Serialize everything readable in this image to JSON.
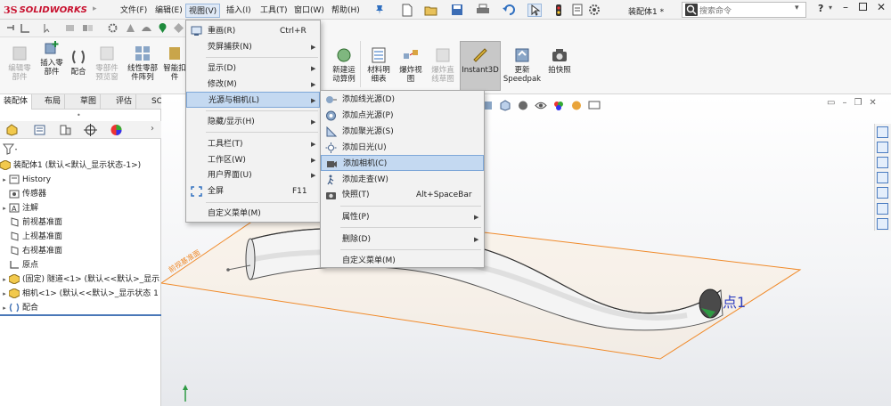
{
  "app": {
    "logo_ds": "3S",
    "logo_text": "SOLIDWORKS",
    "doc_title": "装配体1 *",
    "search_placeholder": "搜索命令",
    "accent_color": "#c8102e"
  },
  "menubar": [
    {
      "label": "文件(F)"
    },
    {
      "label": "编辑(E)"
    },
    {
      "label": "视图(V)"
    },
    {
      "label": "插入(I)"
    },
    {
      "label": "工具(T)"
    },
    {
      "label": "窗口(W)"
    },
    {
      "label": "帮助(H)"
    }
  ],
  "commands": [
    {
      "label1": "编辑零",
      "label2": "部件",
      "disabled": true,
      "icon": "edit-component-icon"
    },
    {
      "label1": "插入零",
      "label2": "部件",
      "disabled": false,
      "icon": "insert-component-icon"
    },
    {
      "label1": "配合",
      "label2": "",
      "disabled": false,
      "icon": "mate-icon"
    },
    {
      "label1": "零部件",
      "label2": "预览窗",
      "disabled": true,
      "icon": "component-preview-icon"
    },
    {
      "label1": "线性零部",
      "label2": "件阵列",
      "disabled": false,
      "icon": "linear-pattern-icon"
    },
    {
      "label1": "智能扣",
      "label2": "件",
      "disabled": false,
      "icon": "smart-fastener-icon"
    },
    {
      "label1": "新建运",
      "label2": "动算例",
      "disabled": false,
      "icon": "motion-study-icon"
    },
    {
      "label1": "材料明",
      "label2": "细表",
      "disabled": false,
      "icon": "bom-icon"
    },
    {
      "label1": "爆炸视",
      "label2": "图",
      "disabled": false,
      "icon": "exploded-view-icon"
    },
    {
      "label1": "爆炸直",
      "label2": "线草图",
      "disabled": true,
      "icon": "explode-line-sketch-icon"
    },
    {
      "label1": "Instant3D",
      "label2": "",
      "disabled": false,
      "icon": "instant3d-icon"
    },
    {
      "label1": "更新",
      "label2": "Speedpak",
      "disabled": false,
      "icon": "speedpak-icon"
    },
    {
      "label1": "拍快照",
      "label2": "",
      "disabled": false,
      "icon": "snapshot-icon"
    }
  ],
  "tabs": [
    {
      "label": "装配体"
    },
    {
      "label": "布局"
    },
    {
      "label": "草图"
    },
    {
      "label": "评估"
    },
    {
      "label": "SOLIDWO"
    }
  ],
  "tree": {
    "root": "装配体1  (默认<默认_显示状态-1>)",
    "items": [
      {
        "label": "History",
        "arrow": "▸",
        "indent": 1
      },
      {
        "label": "传感器",
        "arrow": "",
        "indent": 1
      },
      {
        "label": "注解",
        "arrow": "▸",
        "indent": 1
      },
      {
        "label": "前视基准面",
        "arrow": "",
        "indent": 1
      },
      {
        "label": "上视基准面",
        "arrow": "",
        "indent": 1
      },
      {
        "label": "右视基准面",
        "arrow": "",
        "indent": 1
      },
      {
        "label": "原点",
        "arrow": "",
        "indent": 1
      },
      {
        "label": "(固定) 隧道<1> (默认<<默认>_显示",
        "arrow": "▸",
        "indent": 1
      },
      {
        "label": "相机<1> (默认<<默认>_显示状态 1",
        "arrow": "▸",
        "indent": 1
      },
      {
        "label": "配合",
        "arrow": "▸",
        "indent": 1
      }
    ]
  },
  "view_menu": {
    "items": [
      {
        "label": "重画(R)",
        "shortcut": "Ctrl+R",
        "submenu": false,
        "icon": "redraw-icon"
      },
      {
        "label": "荧屏捕获(N)",
        "shortcut": "",
        "submenu": true,
        "icon": ""
      },
      {
        "label": "显示(D)",
        "shortcut": "",
        "submenu": true,
        "icon": ""
      },
      {
        "label": "修改(M)",
        "shortcut": "",
        "submenu": true,
        "icon": ""
      },
      {
        "label": "光源与相机(L)",
        "shortcut": "",
        "submenu": true,
        "icon": "",
        "highlighted": true
      },
      {
        "label": "隐藏/显示(H)",
        "shortcut": "",
        "submenu": true,
        "icon": ""
      },
      {
        "label": "工具栏(T)",
        "shortcut": "",
        "submenu": true,
        "icon": ""
      },
      {
        "label": "工作区(W)",
        "shortcut": "",
        "submenu": true,
        "icon": ""
      },
      {
        "label": "用户界面(U)",
        "shortcut": "",
        "submenu": true,
        "icon": ""
      },
      {
        "label": "全屏",
        "shortcut": "F11",
        "submenu": false,
        "icon": "fullscreen-icon"
      },
      {
        "label": "自定义菜单(M)",
        "shortcut": "",
        "submenu": false,
        "icon": ""
      }
    ]
  },
  "lights_menu": {
    "items": [
      {
        "label": "添加线光源(D)",
        "shortcut": "",
        "submenu": false,
        "icon": "directional-light-icon"
      },
      {
        "label": "添加点光源(P)",
        "shortcut": "",
        "submenu": false,
        "icon": "point-light-icon"
      },
      {
        "label": "添加聚光源(S)",
        "shortcut": "",
        "submenu": false,
        "icon": "spot-light-icon"
      },
      {
        "label": "添加日光(U)",
        "shortcut": "",
        "submenu": false,
        "icon": "sunlight-icon"
      },
      {
        "label": "添加相机(C)",
        "shortcut": "",
        "submenu": false,
        "icon": "camera-icon",
        "highlighted": true
      },
      {
        "label": "添加走查(W)",
        "shortcut": "",
        "submenu": false,
        "icon": "walkthrough-icon"
      },
      {
        "label": "快照(T)",
        "shortcut": "Alt+SpaceBar",
        "submenu": false,
        "icon": "snapshot-icon"
      },
      {
        "label": "属性(P)",
        "shortcut": "",
        "submenu": true,
        "icon": ""
      },
      {
        "label": "删除(D)",
        "shortcut": "",
        "submenu": true,
        "icon": ""
      },
      {
        "label": "自定义菜单(M)",
        "shortcut": "",
        "submenu": false,
        "icon": ""
      }
    ]
  },
  "viewport": {
    "point_label": "点1",
    "plane_label": "前视基准面"
  }
}
